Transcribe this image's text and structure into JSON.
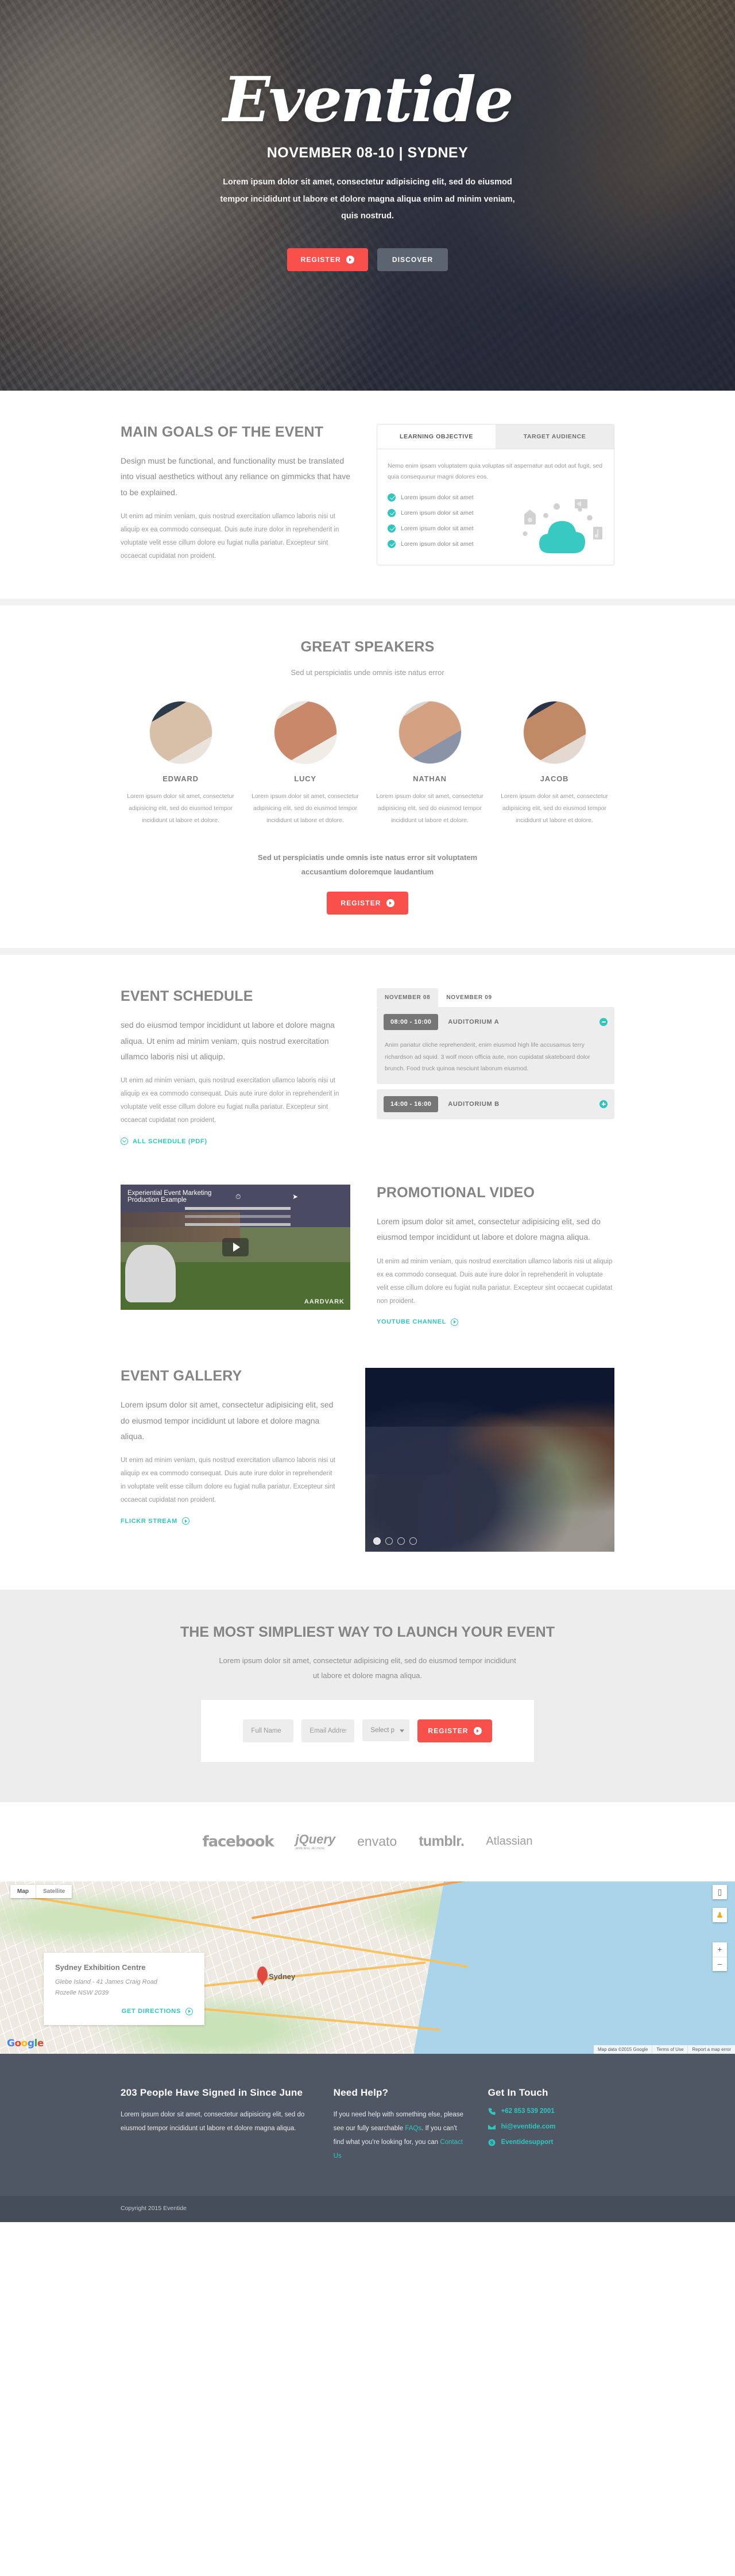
{
  "hero": {
    "logo": "Eventide",
    "date_line": "NOVEMBER 08-10 | SYDNEY",
    "subtitle": "Lorem ipsum dolor sit amet, consectetur adipisicing elit, sed do eiusmod tempor incididunt ut labore et dolore magna aliqua enim ad minim veniam, quis nostrud.",
    "register_label": "REGISTER",
    "discover_label": "DISCOVER"
  },
  "goals": {
    "title": "MAIN GOALS OF THE EVENT",
    "lead": "Design must be functional, and functionality must be translated into visual aesthetics without any reliance on gimmicks that have to be explained.",
    "body": "Ut enim ad minim veniam, quis nostrud exercitation ullamco laboris nisi ut aliquip ex ea commodo consequat. Duis aute irure dolor in reprehenderit in voluptate velit esse cillum dolore eu fugiat nulla pariatur. Excepteur sint occaecat cupidatat non proident.",
    "tabs": [
      {
        "label": "LEARNING OBJECTIVE",
        "active": true
      },
      {
        "label": "TARGET AUDIENCE",
        "active": false
      }
    ],
    "panel_text": "Nemo enim ipsam voluptatem quia voluptas sit aspernatur aut odot aut fugit, sed quia consequunur magni dolores eos.",
    "checklist": [
      "Lorem ipsum dolor sit amet",
      "Lorem ipsum dolor sit amet",
      "Lorem ipsum dolor sit amet",
      "Lorem ipsum dolor sit amet"
    ]
  },
  "speakers": {
    "title": "GREAT SPEAKERS",
    "subtitle": "Sed ut perspiciatis unde omnis iste natus error",
    "items": [
      {
        "name": "EDWARD",
        "bio": "Lorem ipsum dolor sit amet, consectetur adipisicing elit, sed do eiusmod tempor incididunt ut labore et dolore."
      },
      {
        "name": "LUCY",
        "bio": "Lorem ipsum dolor sit amet, consectetur adipisicing elit, sed do eiusmod tempor incididunt ut labore et dolore."
      },
      {
        "name": "NATHAN",
        "bio": "Lorem ipsum dolor sit amet, consectetur adipisicing elit, sed do eiusmod tempor incididunt ut labore et dolore."
      },
      {
        "name": "JACOB",
        "bio": "Lorem ipsum dolor sit amet, consectetur adipisicing elit, sed do eiusmod tempor incididunt ut labore et dolore."
      }
    ],
    "footer_line1": "Sed ut perspiciatis unde omnis iste natus error sit voluptatem",
    "footer_line2": "accusantium doloremque laudantium",
    "register_label": "REGISTER"
  },
  "schedule": {
    "title": "EVENT SCHEDULE",
    "lead": "sed do eiusmod tempor incididunt ut labore et dolore magna aliqua. Ut enim ad minim veniam, quis nostrud exercitation ullamco laboris nisi ut aliquip.",
    "body": "Ut enim ad minim veniam, quis nostrud exercitation ullamco laboris nisi ut aliquip ex ea commodo consequat. Duis aute irure dolor in reprehenderit in voluptate velit esse cillum dolore eu fugiat nulla pariatur. Excepteur sint occaecat cupidatat non proident.",
    "pdf_link": "ALL SCHEDULE (PDF)",
    "day_tabs": [
      {
        "label": "NOVEMBER 08",
        "active": true
      },
      {
        "label": "NOVEMBER 09",
        "active": false
      }
    ],
    "slots": [
      {
        "time": "08:00 - 10:00",
        "room": "AUDITORIUM A",
        "expanded": true,
        "description": "Anim pariatur cliche reprehenderit, enim eiusmod high life accusamus terry richardson ad squid. 3 wolf moon officia aute, non cupidatat skateboard dolor brunch. Food truck quinoa nesciunt laborum eiusmod."
      },
      {
        "time": "14:00 - 16:00",
        "room": "AUDITORIUM B",
        "expanded": false,
        "description": ""
      }
    ]
  },
  "video": {
    "title": "PROMOTIONAL VIDEO",
    "lead": "Lorem ipsum dolor sit amet, consectetur adipisicing elit, sed do eiusmod tempor incididunt ut labore et dolore magna aliqua.",
    "body": "Ut enim ad minim veniam, quis nostrud exercitation ullamco laboris nisi ut aliquip ex ea commodo consequat. Duis aute irure dolor in reprehenderit in voluptate velit esse cillum dolore eu fugiat nulla pariatur. Excepteur sint occaecat cupidatat non proident.",
    "link": "YOUTUBE CHANNEL",
    "player_title": "Experiential Event Marketing Production Example",
    "brand": "AARDVARK"
  },
  "gallery": {
    "title": "EVENT GALLERY",
    "lead": "Lorem ipsum dolor sit amet, consectetur adipisicing elit, sed do eiusmod tempor incididunt ut labore et dolore magna aliqua.",
    "body": "Ut enim ad minim veniam, quis nostrud exercitation ullamco laboris nisi ut aliquip ex ea commodo consequat. Duis aute irure dolor in reprehenderit in voluptate velit esse cillum dolore eu fugiat nulla pariatur. Excepteur sint occaecat cupidatat non proident.",
    "link": "FLICKR STREAM",
    "slide_count": 4,
    "active_slide": 1
  },
  "cta": {
    "title": "THE MOST SIMPLIEST WAY TO LAUNCH YOUR EVENT",
    "subtitle": "Lorem ipsum dolor sit amet, consectetur adipisicing elit, sed do eiusmod tempor incididunt ut labore et dolore magna aliqua.",
    "name_placeholder": "Full Name",
    "email_placeholder": "Email Address",
    "plan_selected": "Select plan",
    "plan_options": [
      "Select plan"
    ],
    "register_label": "REGISTER"
  },
  "sponsors": [
    {
      "name": "facebook",
      "icon": "facebook-logo"
    },
    {
      "name": "jQuery",
      "tagline": "write less, do more.",
      "icon": "jquery-logo"
    },
    {
      "name": "envato",
      "icon": "envato-logo"
    },
    {
      "name": "tumblr.",
      "icon": "tumblr-logo"
    },
    {
      "name": "Atlassian",
      "icon": "atlassian-logo"
    }
  ],
  "map": {
    "type_buttons": [
      "Map",
      "Satellite"
    ],
    "venue_name": "Sydney Exhibition Centre",
    "address_line1": "Glebe Island - 41 James Craig Road",
    "address_line2": "Rozelle NSW 2039",
    "directions_label": "GET DIRECTIONS",
    "marker_label": "Sydney",
    "logo": "Google",
    "credits": [
      "Map data ©2015 Google",
      "Terms of Use",
      "Report a map error"
    ],
    "zoom_in": "+",
    "zoom_out": "−"
  },
  "footer": {
    "col1": {
      "count": "203",
      "title_rest": " People Have Signed in Since June",
      "text": "Lorem ipsum dolor sit amet, consectetur adipisicing elit, sed do eiusmod tempor incididunt ut labore et dolore magna aliqua."
    },
    "col2": {
      "title": "Need Help?",
      "text_part1": "If you need help with something else, please see our fully searchable ",
      "link1": "FAQs",
      "text_part2": ". If you can't find what you're looking for, you can ",
      "link2": "Contact Us"
    },
    "col3": {
      "title": "Get In Touch",
      "items": [
        {
          "icon": "phone-icon",
          "value": "+62 853 539 2001"
        },
        {
          "icon": "mail-icon",
          "value": "hi@eventide.com"
        },
        {
          "icon": "skype-icon",
          "value": "Eventidesupport"
        }
      ]
    },
    "copyright": "Copyright 2015 Eventide"
  },
  "colors": {
    "accent_red": "#f9504b",
    "accent_teal": "#2ec7c0",
    "footer_bg": "#4e5763",
    "grey_bg": "#ededed"
  }
}
